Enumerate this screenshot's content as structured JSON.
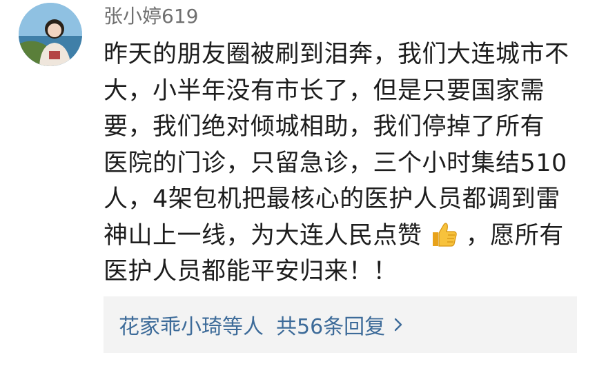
{
  "comment": {
    "username": "张小婷619",
    "avatar_icon": "user-avatar-photo",
    "lines": [
      "昨天的朋友圈被刷到泪奔，我们大连城市不",
      "大，小半年没有市长了，但是只要国家需",
      "要，我们绝对倾城相助，我们停掉了所有",
      "医院的门诊，只留急诊，三个小时集结510",
      "人，4架包机把最核心的医护人员都调到雷"
    ],
    "line6_before": "神山上一线，为大连人民点赞",
    "line6_emoji": "thumbs-up-emoji",
    "line6_after": "，愿所有",
    "line7": "医护人员都能平安归来！！"
  },
  "replies": {
    "name": "花家乖小琦",
    "suffix": "等人",
    "count_text": "共56条回复",
    "chevron_icon": "chevron-right-icon"
  }
}
